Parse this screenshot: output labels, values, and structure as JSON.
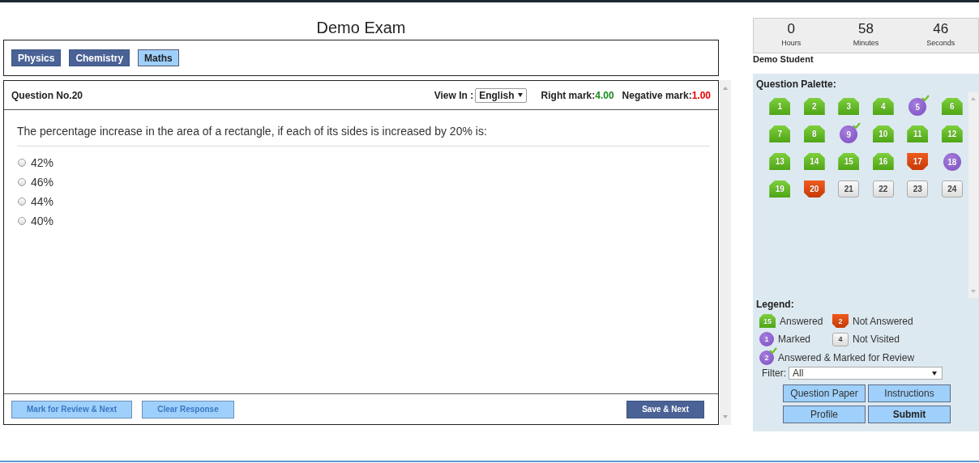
{
  "exam_title": "Demo Exam",
  "subjects": [
    {
      "label": "Physics",
      "selected": false
    },
    {
      "label": "Chemistry",
      "selected": false
    },
    {
      "label": "Maths",
      "selected": true
    }
  ],
  "question": {
    "number_label": "Question No.20",
    "view_in_label": "View In :",
    "language": "English",
    "right_mark_label": "Right mark:",
    "right_mark": "4.00",
    "negative_mark_label": "Negative mark:",
    "negative_mark": "1.00",
    "text": "The percentage increase in the area of a rectangle, if each of its sides is increased by 20% is:",
    "options": [
      {
        "label": "42%",
        "selected": false
      },
      {
        "label": "46%",
        "selected": false
      },
      {
        "label": "44%",
        "selected": false
      },
      {
        "label": "40%",
        "selected": false
      }
    ]
  },
  "question_buttons": [
    {
      "label": "Mark for Review & Next",
      "kind": "secondary"
    },
    {
      "label": "Clear Response",
      "kind": "secondary"
    },
    {
      "label": "Save & Next",
      "kind": "primary"
    }
  ],
  "timer": [
    {
      "value": "0",
      "unit": "Hours"
    },
    {
      "value": "58",
      "unit": "Minutes"
    },
    {
      "value": "46",
      "unit": "Seconds"
    }
  ],
  "student_name": "Demo Student",
  "palette": {
    "title": "Question Palette:",
    "questions": [
      {
        "number": "1",
        "kind": "answered"
      },
      {
        "number": "2",
        "kind": "answered"
      },
      {
        "number": "3",
        "kind": "answered"
      },
      {
        "number": "4",
        "kind": "answered"
      },
      {
        "number": "5",
        "kind": "reviewed"
      },
      {
        "number": "6",
        "kind": "answered"
      },
      {
        "number": "7",
        "kind": "answered"
      },
      {
        "number": "8",
        "kind": "answered"
      },
      {
        "number": "9",
        "kind": "reviewed"
      },
      {
        "number": "10",
        "kind": "answered"
      },
      {
        "number": "11",
        "kind": "answered"
      },
      {
        "number": "12",
        "kind": "answered"
      },
      {
        "number": "13",
        "kind": "answered"
      },
      {
        "number": "14",
        "kind": "answered"
      },
      {
        "number": "15",
        "kind": "answered"
      },
      {
        "number": "16",
        "kind": "answered"
      },
      {
        "number": "17",
        "kind": "unanswered"
      },
      {
        "number": "18",
        "kind": "marked"
      },
      {
        "number": "19",
        "kind": "answered"
      },
      {
        "number": "20",
        "kind": "unanswered"
      },
      {
        "number": "21",
        "kind": "unvisited"
      },
      {
        "number": "22",
        "kind": "unvisited"
      },
      {
        "number": "23",
        "kind": "unvisited"
      },
      {
        "number": "24",
        "kind": "unvisited"
      }
    ]
  },
  "legend": {
    "title": "Legend:",
    "items": [
      {
        "count": "15",
        "label": "Answered",
        "kind": "answered"
      },
      {
        "count": "2",
        "label": "Not Answered",
        "kind": "unanswered"
      },
      {
        "count": "1",
        "label": "Marked",
        "kind": "marked"
      },
      {
        "count": "4",
        "label": "Not Visited",
        "kind": "unvisited"
      },
      {
        "count": "2",
        "label": "Answered & Marked for Review",
        "kind": "reviewed"
      }
    ]
  },
  "filter": {
    "label": "Filter:",
    "value": "All"
  },
  "side_buttons": [
    {
      "label": "Question Paper",
      "kind": "normal"
    },
    {
      "label": "Instructions",
      "kind": "normal"
    },
    {
      "label": "Profile",
      "kind": "normal"
    },
    {
      "label": "Submit",
      "kind": "strong"
    }
  ]
}
